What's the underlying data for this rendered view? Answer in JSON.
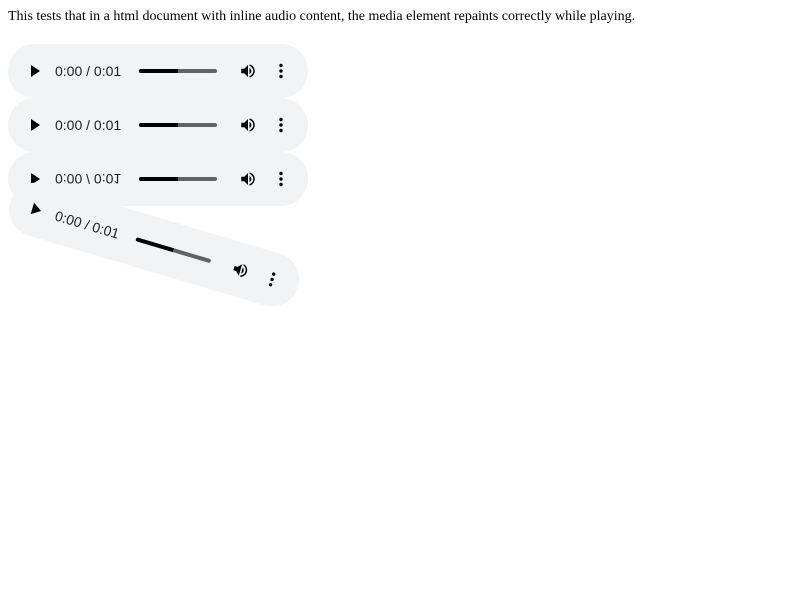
{
  "description": "This tests that in a html document with inline audio content, the media element repaints correctly while playing.",
  "players": [
    {
      "time": "0:00 / 0:01",
      "progress": 0.5
    },
    {
      "time": "0:00 / 0:01",
      "progress": 0.5
    },
    {
      "time": "0:00 / 0:01",
      "progress": 0.5
    },
    {
      "time": "0:00 / 0:01",
      "progress": 0.5
    }
  ],
  "icons": {
    "play": "play-icon",
    "volume": "volume-icon",
    "menu": "more-vert-icon"
  },
  "colors": {
    "player_background": "#f1f3f4",
    "seek_track": "#5f6368",
    "seek_fill": "#000000"
  }
}
